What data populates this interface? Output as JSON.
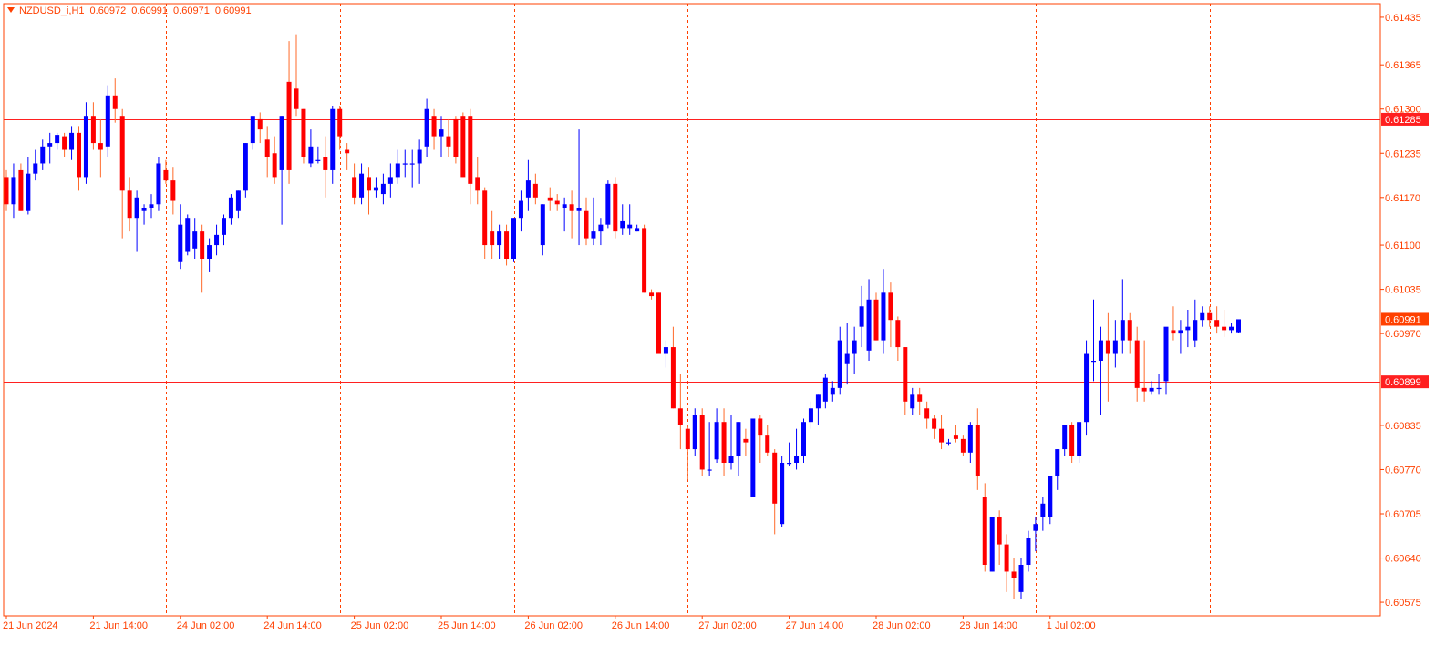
{
  "colors": {
    "background": "#ffffff",
    "frame": "#ff4000",
    "axis_text": "#ff4000",
    "bull": "#0000ff",
    "bear": "#ff0000",
    "neutral_highlight": "#00c800",
    "wick_bull": "#0000ff",
    "wick_bear": "#ff6a2a",
    "hline": "#ff2020",
    "hline_label_bg": "#ff2020",
    "current_label_bg": "#ff4000",
    "vgrid": "#ff4000"
  },
  "header": {
    "symbol": "NZDUSD_i,H1",
    "open": "0.60972",
    "high": "0.60991",
    "low": "0.60971",
    "close": "0.60991"
  },
  "chart_data": {
    "type": "candlestick",
    "symbol": "NZDUSD_i",
    "timeframe": "H1",
    "ylim": [
      0.60555,
      0.61455
    ],
    "y_ticks": [
      "0.61435",
      "0.61365",
      "0.61300",
      "0.61235",
      "0.61170",
      "0.61100",
      "0.61035",
      "0.60970",
      "0.60835",
      "0.60770",
      "0.60705",
      "0.60640",
      "0.60575"
    ],
    "x_labels": [
      "21 Jun 2024",
      "21 Jun 14:00",
      "24 Jun 02:00",
      "24 Jun 14:00",
      "25 Jun 02:00",
      "25 Jun 14:00",
      "26 Jun 02:00",
      "26 Jun 14:00",
      "27 Jun 02:00",
      "27 Jun 14:00",
      "28 Jun 02:00",
      "28 Jun 14:00",
      "1 Jul 02:00"
    ],
    "x_label_bars": [
      0,
      12,
      24,
      36,
      48,
      60,
      72,
      84,
      96,
      108,
      120,
      132,
      144
    ],
    "vgrid_bars": [
      22,
      46,
      70,
      94,
      118,
      142,
      166
    ],
    "horizontal_lines": [
      {
        "price": "0.61285",
        "role": "level"
      },
      {
        "price": "0.60899",
        "role": "level"
      }
    ],
    "current_price": "0.60991",
    "candles": [
      [
        0.612,
        0.6121,
        0.6115,
        0.6116
      ],
      [
        0.6116,
        0.6122,
        0.6114,
        0.612
      ],
      [
        0.6121,
        0.6122,
        0.6115,
        0.6115
      ],
      [
        0.6115,
        0.6123,
        0.61145,
        0.61205
      ],
      [
        0.61205,
        0.6124,
        0.61195,
        0.6122
      ],
      [
        0.6122,
        0.61255,
        0.6121,
        0.61245
      ],
      [
        0.61245,
        0.61265,
        0.6122,
        0.6125
      ],
      [
        0.6125,
        0.61265,
        0.6124,
        0.61262
      ],
      [
        0.6126,
        0.61265,
        0.6123,
        0.6124
      ],
      [
        0.6124,
        0.61275,
        0.61225,
        0.61265
      ],
      [
        0.61265,
        0.61275,
        0.6118,
        0.612
      ],
      [
        0.612,
        0.6131,
        0.6119,
        0.6129
      ],
      [
        0.6129,
        0.6131,
        0.6124,
        0.6125
      ],
      [
        0.6125,
        0.61285,
        0.612,
        0.6124
      ],
      [
        0.61245,
        0.61335,
        0.6123,
        0.6132
      ],
      [
        0.6132,
        0.61345,
        0.6128,
        0.613
      ],
      [
        0.6129,
        0.613,
        0.6111,
        0.6118
      ],
      [
        0.6118,
        0.612,
        0.6112,
        0.6114
      ],
      [
        0.6114,
        0.6118,
        0.6109,
        0.6117
      ],
      [
        0.6115,
        0.6116,
        0.6113,
        0.61155
      ],
      [
        0.61155,
        0.61175,
        0.6114,
        0.6116
      ],
      [
        0.6116,
        0.6123,
        0.6115,
        0.6122
      ],
      [
        0.6121,
        0.61225,
        0.6119,
        0.61195
      ],
      [
        0.61195,
        0.61215,
        0.61145,
        0.61165
      ],
      [
        0.61075,
        0.6116,
        0.61065,
        0.6113
      ],
      [
        0.6109,
        0.61145,
        0.61085,
        0.6114
      ],
      [
        0.61095,
        0.6114,
        0.6108,
        0.6112
      ],
      [
        0.6112,
        0.6113,
        0.6103,
        0.6108
      ],
      [
        0.6108,
        0.6111,
        0.6106,
        0.611
      ],
      [
        0.611,
        0.6113,
        0.61085,
        0.61115
      ],
      [
        0.61115,
        0.61145,
        0.611,
        0.6114
      ],
      [
        0.6114,
        0.61175,
        0.6113,
        0.6117
      ],
      [
        0.6115,
        0.6118,
        0.6114,
        0.6118
      ],
      [
        0.6118,
        0.6125,
        0.6117,
        0.6125
      ],
      [
        0.6125,
        0.6129,
        0.6124,
        0.6129
      ],
      [
        0.61285,
        0.61295,
        0.6125,
        0.6127
      ],
      [
        0.61255,
        0.61275,
        0.612,
        0.6123
      ],
      [
        0.61235,
        0.6126,
        0.6119,
        0.612
      ],
      [
        0.6121,
        0.6129,
        0.6113,
        0.6129
      ],
      [
        0.6134,
        0.614,
        0.6119,
        0.6121
      ],
      [
        0.6133,
        0.6141,
        0.6129,
        0.613
      ],
      [
        0.613,
        0.613,
        0.6122,
        0.6123
      ],
      [
        0.6122,
        0.6127,
        0.61215,
        0.61245
      ],
      [
        0.61225,
        0.61245,
        0.6122,
        0.61225
      ],
      [
        0.6123,
        0.6126,
        0.6117,
        0.6121
      ],
      [
        0.6121,
        0.61305,
        0.6119,
        0.613
      ],
      [
        0.613,
        0.61305,
        0.6124,
        0.6126
      ],
      [
        0.6124,
        0.6125,
        0.6121,
        0.61235
      ],
      [
        0.612,
        0.6122,
        0.6116,
        0.6117
      ],
      [
        0.6117,
        0.6122,
        0.6116,
        0.61205
      ],
      [
        0.612,
        0.61215,
        0.61145,
        0.6118
      ],
      [
        0.6118,
        0.612,
        0.6117,
        0.61185
      ],
      [
        0.61175,
        0.61205,
        0.6116,
        0.6119
      ],
      [
        0.6119,
        0.6122,
        0.6117,
        0.612
      ],
      [
        0.612,
        0.6124,
        0.6119,
        0.6122
      ],
      [
        0.6122,
        0.6124,
        0.612,
        0.6122
      ],
      [
        0.6122,
        0.6124,
        0.61185,
        0.6122
      ],
      [
        0.6122,
        0.61255,
        0.6119,
        0.6124
      ],
      [
        0.61245,
        0.61315,
        0.6123,
        0.613
      ],
      [
        0.6129,
        0.613,
        0.6124,
        0.6126
      ],
      [
        0.6126,
        0.6129,
        0.6123,
        0.6127
      ],
      [
        0.6126,
        0.61285,
        0.6123,
        0.61245
      ],
      [
        0.61285,
        0.6129,
        0.6122,
        0.6123
      ],
      [
        0.6129,
        0.61295,
        0.612,
        0.612
      ],
      [
        0.6129,
        0.613,
        0.6116,
        0.6119
      ],
      [
        0.612,
        0.6123,
        0.6116,
        0.6118
      ],
      [
        0.6118,
        0.61185,
        0.6108,
        0.611
      ],
      [
        0.6112,
        0.6115,
        0.6108,
        0.611
      ],
      [
        0.611,
        0.6113,
        0.6108,
        0.6112
      ],
      [
        0.6112,
        0.6113,
        0.6107,
        0.6108
      ],
      [
        0.6108,
        0.6114,
        0.61075,
        0.6114
      ],
      [
        0.6114,
        0.6118,
        0.6112,
        0.61165
      ],
      [
        0.6117,
        0.61225,
        0.6115,
        0.61195
      ],
      [
        0.6119,
        0.61205,
        0.6116,
        0.6117
      ],
      [
        0.611,
        0.6116,
        0.61085,
        0.6116
      ],
      [
        0.6117,
        0.61185,
        0.6115,
        0.61165
      ],
      [
        0.61165,
        0.61175,
        0.6115,
        0.6116
      ],
      [
        0.61155,
        0.6117,
        0.6112,
        0.6116
      ],
      [
        0.6116,
        0.6118,
        0.6111,
        0.6115
      ],
      [
        0.6115,
        0.6127,
        0.611,
        0.61155
      ],
      [
        0.6115,
        0.6117,
        0.611,
        0.6111
      ],
      [
        0.6111,
        0.6117,
        0.611,
        0.6112
      ],
      [
        0.6112,
        0.6114,
        0.611,
        0.6113
      ],
      [
        0.6113,
        0.61195,
        0.61125,
        0.6119
      ],
      [
        0.6119,
        0.612,
        0.6111,
        0.6112
      ],
      [
        0.61125,
        0.6116,
        0.61115,
        0.61135
      ],
      [
        0.61125,
        0.6116,
        0.61115,
        0.6113
      ],
      [
        0.6112,
        0.6113,
        0.6112,
        0.61125
      ],
      [
        0.61125,
        0.6113,
        0.6103,
        0.6103
      ],
      [
        0.6103,
        0.61035,
        0.6102,
        0.61025
      ],
      [
        0.6103,
        0.6103,
        0.6094,
        0.6094
      ],
      [
        0.6094,
        0.6096,
        0.6092,
        0.6095
      ],
      [
        0.6095,
        0.6098,
        0.6086,
        0.6086
      ],
      [
        0.6086,
        0.6091,
        0.608,
        0.60835
      ],
      [
        0.6083,
        0.60835,
        0.60755,
        0.608
      ],
      [
        0.608,
        0.6086,
        0.6079,
        0.6085
      ],
      [
        0.6085,
        0.6086,
        0.6076,
        0.6077
      ],
      [
        0.6077,
        0.6084,
        0.6076,
        0.6077
      ],
      [
        0.60785,
        0.6086,
        0.6078,
        0.6084
      ],
      [
        0.6084,
        0.6086,
        0.6076,
        0.6078
      ],
      [
        0.6078,
        0.6085,
        0.6077,
        0.6079
      ],
      [
        0.6079,
        0.6084,
        0.6076,
        0.6084
      ],
      [
        0.60815,
        0.6083,
        0.6079,
        0.6081
      ],
      [
        0.6073,
        0.6084,
        0.6073,
        0.60845
      ],
      [
        0.60845,
        0.6085,
        0.6078,
        0.6082
      ],
      [
        0.6082,
        0.60835,
        0.6079,
        0.60795
      ],
      [
        0.60795,
        0.608,
        0.60675,
        0.6072
      ],
      [
        0.6069,
        0.6079,
        0.60685,
        0.6078
      ],
      [
        0.6078,
        0.6081,
        0.60775,
        0.6078
      ],
      [
        0.6078,
        0.6083,
        0.6077,
        0.6079
      ],
      [
        0.6079,
        0.60845,
        0.6078,
        0.6084
      ],
      [
        0.6084,
        0.6087,
        0.6083,
        0.6086
      ],
      [
        0.6086,
        0.6088,
        0.60835,
        0.6088
      ],
      [
        0.6087,
        0.6091,
        0.6086,
        0.60905
      ],
      [
        0.6088,
        0.609,
        0.6087,
        0.6089
      ],
      [
        0.6089,
        0.6098,
        0.6088,
        0.6096
      ],
      [
        0.60925,
        0.60985,
        0.60895,
        0.6094
      ],
      [
        0.6094,
        0.6098,
        0.6091,
        0.6096
      ],
      [
        0.6098,
        0.6104,
        0.6095,
        0.6101
      ],
      [
        0.60945,
        0.6105,
        0.6093,
        0.6102
      ],
      [
        0.6102,
        0.6103,
        0.6096,
        0.6096
      ],
      [
        0.6096,
        0.61065,
        0.6094,
        0.6103
      ],
      [
        0.6103,
        0.61045,
        0.6095,
        0.6099
      ],
      [
        0.6099,
        0.60995,
        0.6093,
        0.6095
      ],
      [
        0.6095,
        0.6095,
        0.6085,
        0.6087
      ],
      [
        0.6086,
        0.6089,
        0.6085,
        0.6088
      ],
      [
        0.6088,
        0.6089,
        0.6085,
        0.6087
      ],
      [
        0.6086,
        0.6087,
        0.6083,
        0.60845
      ],
      [
        0.60845,
        0.6085,
        0.60815,
        0.6083
      ],
      [
        0.6083,
        0.6085,
        0.608,
        0.6081
      ],
      [
        0.6081,
        0.60815,
        0.60805,
        0.6081
      ],
      [
        0.6082,
        0.60835,
        0.6081,
        0.60815
      ],
      [
        0.60815,
        0.6082,
        0.6079,
        0.60795
      ],
      [
        0.60795,
        0.6084,
        0.6078,
        0.60835
      ],
      [
        0.60835,
        0.6086,
        0.6074,
        0.6076
      ],
      [
        0.6073,
        0.6075,
        0.6062,
        0.6063
      ],
      [
        0.6062,
        0.607,
        0.6062,
        0.607
      ],
      [
        0.607,
        0.6071,
        0.6063,
        0.6066
      ],
      [
        0.6066,
        0.60675,
        0.6059,
        0.6062
      ],
      [
        0.6062,
        0.6064,
        0.6058,
        0.6061
      ],
      [
        0.6059,
        0.6064,
        0.6058,
        0.6063
      ],
      [
        0.6063,
        0.6068,
        0.6062,
        0.6067
      ],
      [
        0.6068,
        0.607,
        0.6065,
        0.6069
      ],
      [
        0.607,
        0.6073,
        0.6068,
        0.6072
      ],
      [
        0.607,
        0.6076,
        0.6069,
        0.6076
      ],
      [
        0.6076,
        0.608,
        0.6074,
        0.608
      ],
      [
        0.608,
        0.60835,
        0.6079,
        0.60835
      ],
      [
        0.60835,
        0.6084,
        0.6078,
        0.6079
      ],
      [
        0.6079,
        0.6084,
        0.6078,
        0.6084
      ],
      [
        0.6084,
        0.6096,
        0.6082,
        0.6094
      ],
      [
        0.6093,
        0.6102,
        0.609,
        0.6093
      ],
      [
        0.6093,
        0.6098,
        0.6085,
        0.6096
      ],
      [
        0.6096,
        0.61,
        0.6087,
        0.6094
      ],
      [
        0.6094,
        0.6099,
        0.6092,
        0.6096
      ],
      [
        0.6096,
        0.6105,
        0.6094,
        0.6099
      ],
      [
        0.6099,
        0.61,
        0.6094,
        0.6096
      ],
      [
        0.6096,
        0.6098,
        0.6087,
        0.6089
      ],
      [
        0.6089,
        0.6096,
        0.6087,
        0.60885
      ],
      [
        0.60885,
        0.609,
        0.6088,
        0.6089
      ],
      [
        0.6089,
        0.6091,
        0.6088,
        0.6089
      ],
      [
        0.609,
        0.6097,
        0.6088,
        0.6098
      ],
      [
        0.60975,
        0.6101,
        0.6096,
        0.6097
      ],
      [
        0.6097,
        0.6099,
        0.6094,
        0.60975
      ],
      [
        0.60975,
        0.61005,
        0.6095,
        0.6098
      ],
      [
        0.6096,
        0.6102,
        0.6095,
        0.6099
      ],
      [
        0.6099,
        0.6101,
        0.6098,
        0.61
      ],
      [
        0.61,
        0.6101,
        0.6098,
        0.6099
      ],
      [
        0.6099,
        0.6101,
        0.6097,
        0.6098
      ],
      [
        0.6098,
        0.61005,
        0.60965,
        0.60975
      ],
      [
        0.60975,
        0.60985,
        0.6097,
        0.6098
      ],
      [
        0.60972,
        0.60991,
        0.60971,
        0.60991
      ]
    ]
  }
}
